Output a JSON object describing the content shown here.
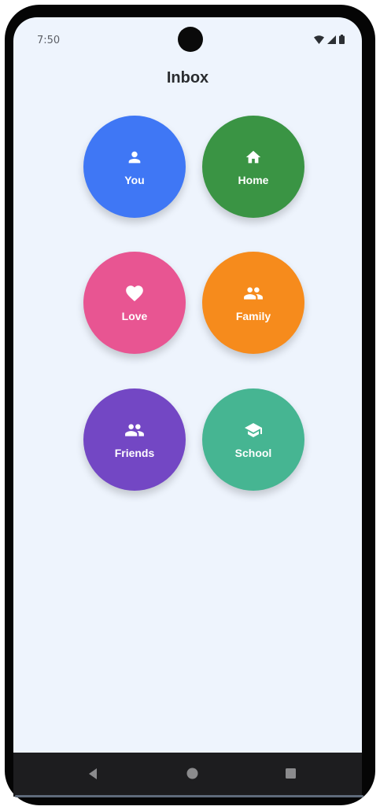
{
  "status_bar": {
    "time": "7:50"
  },
  "header": {
    "title": "Inbox"
  },
  "categories": [
    {
      "label": "You",
      "icon": "person-icon",
      "color": "#3f77f5"
    },
    {
      "label": "Home",
      "icon": "home-icon",
      "color": "#3a9444"
    },
    {
      "label": "Love",
      "icon": "heart-icon",
      "color": "#e85592"
    },
    {
      "label": "Family",
      "icon": "group-icon",
      "color": "#f68b1c"
    },
    {
      "label": "Friends",
      "icon": "group-icon",
      "color": "#7347c4"
    },
    {
      "label": "School",
      "icon": "school-icon",
      "color": "#46b592"
    }
  ],
  "colors": {
    "background": "#eef4fd",
    "title": "#2a2c30",
    "frame": "#050505"
  }
}
